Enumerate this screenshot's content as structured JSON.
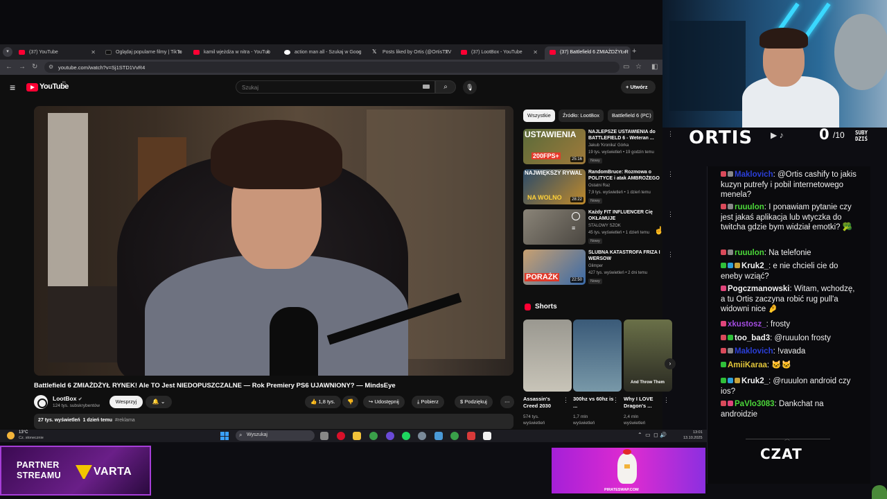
{
  "colors": {
    "yt_bg": "#0f0f0f",
    "yt_red": "#ff0033",
    "partner_purple": "#6a1f88",
    "chat_bg": "#0a0a0d"
  },
  "browser": {
    "tabs": [
      {
        "title": "(37) YouTube",
        "icon": "youtube-icon"
      },
      {
        "title": "Oglądaj popularne filmy | TikTo",
        "icon": "tiktok-icon"
      },
      {
        "title": "kamil wjeżdża w nitra - YouTub",
        "icon": "youtube-icon"
      },
      {
        "title": "action man all - Szukaj w Goog",
        "icon": "google-icon"
      },
      {
        "title": "Posts liked by Ortis (@OrtisTTV",
        "icon": "x-icon"
      },
      {
        "title": "(37) LootBox - YouTube",
        "icon": "youtube-icon"
      },
      {
        "title": "(37) Battlefield 6 ZMIAŻDŻYŁ R",
        "icon": "youtube-icon",
        "active": true
      }
    ],
    "url": "youtube.com/watch?v=Sj1STD1VvR4"
  },
  "youtube": {
    "logo_text": "YouTube",
    "logo_region": "PL",
    "search_placeholder": "Szukaj",
    "create_label": "Utwórz",
    "video": {
      "title": "Battlefield 6 ZMIAŻDŻYŁ RYNEK! Ale TO Jest NIEDOPUSZCZALNE — Rok Premiery PS6 UJAWNIONY? — MindsEye",
      "channel": "LootBox",
      "subscribers": "124 tys. subskrybentów",
      "support_label": "Wesprzyj",
      "likes": "1,8 tys.",
      "share_label": "Udostępnij",
      "download_label": "Pobierz",
      "thanks_label": "Podziękuj",
      "views": "27 tys. wyświetleń",
      "age": "1 dzień temu",
      "tag": "#reklama"
    },
    "chips": [
      "Wszystkie",
      "Źródło: LootBox",
      "Battlefield 6 (PC)"
    ],
    "recommendations": [
      {
        "thumb_text": "USTAWIENIA",
        "thumb_sub": "200FPS+",
        "duration": "25:16",
        "title": "NAJLEPSZE USTAWIENIA do BATTLEFIELD 6 - Weteran ...",
        "channel": "Jakub 'Kronika' Górka",
        "meta": "19 tys. wyświetleń • 19 godzin temu",
        "badge": "Nowy"
      },
      {
        "thumb_text": "NAJWIĘKSZY RYWAL",
        "thumb_sub": "NA WOLNO",
        "duration": "28:22",
        "title": "RandomBruce: Rozmowa o POLITYCE i atak AMBROŻEGO",
        "channel": "Ostatni Raz",
        "meta": "7,9 tys. wyświetleń • 1 dzień temu",
        "badge": "Nowy"
      },
      {
        "thumb_text": "",
        "thumb_sub": "",
        "duration": "",
        "title": "Każdy FIT INFLUENCER Cię OKŁAMUJE",
        "channel": "STALOWY SZOK",
        "meta": "45 tys. wyświetleń • 1 dzień temu",
        "badge": "Nowy"
      },
      {
        "thumb_text": "",
        "thumb_sub": "PORAŻK",
        "duration": "22:50",
        "title": "ŚLUBNA KATASTROFA FRIZA I WERSOW",
        "channel": "Glimper",
        "meta": "427 tys. wyświetleń • 2 dni temu",
        "badge": "Nowy"
      }
    ],
    "shorts_label": "Shorts",
    "shorts": [
      {
        "title": "Assassin's Creed 2030",
        "views": "574 tys.",
        "views_unit": "wyświetleń"
      },
      {
        "title": "300hz vs 60hz is ...",
        "views": "1,7 mln",
        "views_unit": "wyświetleń"
      },
      {
        "title": "Why I LOVE Dragon's ...",
        "views": "2,4 mln",
        "views_unit": "wyświetleń",
        "overlay": "And Throw Them"
      }
    ]
  },
  "taskbar": {
    "weather_temp": "13°C",
    "weather_desc": "Cz. słonecznie",
    "search_placeholder": "Wyszukaj",
    "time": "13:01",
    "date": "13.10.2025"
  },
  "overlay": {
    "partner_line1": "PARTNER",
    "partner_line2": "STREAMU",
    "sponsor": "VARTA",
    "promo_url": "PIRATESWAP.COM",
    "brand": "ORTIS",
    "subs_count": "0",
    "subs_goal": "/10",
    "subs_label1": "SUBY",
    "subs_label2": "DZIŚ",
    "chat_label": "CZAT"
  },
  "chat": [
    {
      "user": "Maklovich",
      "color": "#2b3fd8",
      "badges": [
        "#d94a5a",
        "#888"
      ],
      "text": "@Ortis cashify to jakis kuzyn putrefy i pobil internetowego menela?"
    },
    {
      "user": "ruuulon",
      "color": "#4cd83a",
      "badges": [
        "#d94a5a",
        "#888"
      ],
      "text": "I ponawiam pytanie czy jest jakaś aplikacja lub wtyczka do twitcha gdzie bym widział emotki? 🥦"
    },
    {
      "user": "ruuulon",
      "color": "#4cd83a",
      "badges": [
        "#d94a5a",
        "#888"
      ],
      "text": "Na telefonie"
    },
    {
      "user": "Kruk2_",
      "color": "#f2f2f2",
      "badges": [
        "#2fbf3a",
        "#2f9fd8",
        "#c8a23a"
      ],
      "text": "e nie chcieli cie do eneby wziąć?"
    },
    {
      "user": "Pogczmanowski",
      "color": "#f2f2f2",
      "badges": [
        "#e0457b"
      ],
      "text": "Witam, wchodzę, a tu Ortis zaczyna robić rug pull'a widowni nice 🤌"
    },
    {
      "user": "xkustosz_",
      "color": "#a34ce0",
      "badges": [
        "#e0457b"
      ],
      "text": "frosty"
    },
    {
      "user": "too_bad3",
      "color": "#f2f2f2",
      "badges": [
        "#d94a5a",
        "#2fbf3a"
      ],
      "text": "@ruuulon frosty"
    },
    {
      "user": "Maklovich",
      "color": "#2b3fd8",
      "badges": [
        "#d94a5a",
        "#888"
      ],
      "text": "!vavada"
    },
    {
      "user": "AmiiKaraa",
      "color": "#e0c43a",
      "badges": [
        "#2fbf3a"
      ],
      "text": "🐱🐱"
    },
    {
      "user": "Kruk2_",
      "color": "#f2f2f2",
      "badges": [
        "#2fbf3a",
        "#2f9fd8",
        "#c8a23a"
      ],
      "text": "@ruuulon android czy ios?"
    },
    {
      "user": "PaVlo3083",
      "color": "#4cd83a",
      "badges": [
        "#d94a5a",
        "#e0457b"
      ],
      "text": "Dankchat na androidzie"
    }
  ]
}
